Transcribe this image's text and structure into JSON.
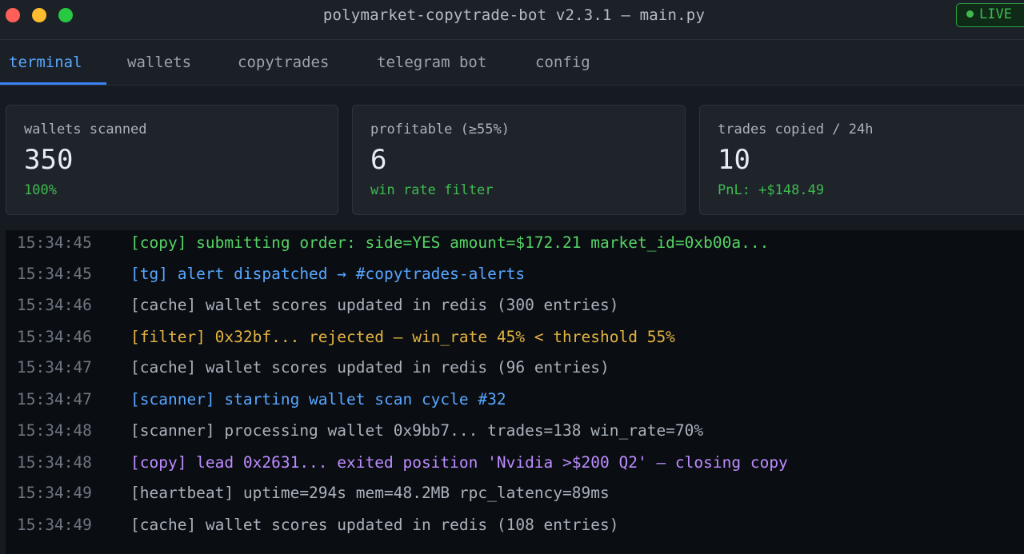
{
  "window": {
    "title": "polymarket-copytrade-bot v2.3.1 — main.py",
    "live_label": "LIVE"
  },
  "tabs": [
    {
      "label": "terminal",
      "active": true
    },
    {
      "label": "wallets",
      "active": false
    },
    {
      "label": "copytrades",
      "active": false
    },
    {
      "label": "telegram bot",
      "active": false
    },
    {
      "label": "config",
      "active": false
    }
  ],
  "stats": [
    {
      "label": "wallets scanned",
      "value": "350",
      "sub": "100%"
    },
    {
      "label": "profitable (≥55%)",
      "value": "6",
      "sub": "win rate filter"
    },
    {
      "label": "trades copied / 24h",
      "value": "10",
      "sub": "PnL: +$148.49"
    }
  ],
  "log": [
    {
      "time": "15:34:45",
      "text": "[copy] submitting order: side=YES amount=$172.21 market_id=0xb00a...",
      "color": "green"
    },
    {
      "time": "15:34:45",
      "text": "[tg] alert dispatched → #copytrades-alerts",
      "color": "blue"
    },
    {
      "time": "15:34:46",
      "text": "[cache] wallet scores updated in redis (300 entries)",
      "color": "gray"
    },
    {
      "time": "15:34:46",
      "text": "[filter] 0x32bf... rejected — win_rate 45% < threshold 55%",
      "color": "amber"
    },
    {
      "time": "15:34:47",
      "text": "[cache] wallet scores updated in redis (96 entries)",
      "color": "gray"
    },
    {
      "time": "15:34:47",
      "text": "[scanner] starting wallet scan cycle #32",
      "color": "blue"
    },
    {
      "time": "15:34:48",
      "text": "[scanner] processing wallet 0x9bb7... trades=138 win_rate=70%",
      "color": "gray"
    },
    {
      "time": "15:34:48",
      "text": "[copy] lead 0x2631... exited position 'Nvidia >$200 Q2' — closing copy",
      "color": "purple"
    },
    {
      "time": "15:34:49",
      "text": "[heartbeat] uptime=294s mem=48.2MB rpc_latency=89ms",
      "color": "gray"
    },
    {
      "time": "15:34:49",
      "text": "[cache] wallet scores updated in redis (108 entries)",
      "color": "gray"
    }
  ],
  "colors": {
    "green": "#56d364",
    "blue": "#58a6ff",
    "gray": "#a9b1bb",
    "amber": "#e3b341",
    "purple": "#bc8cff",
    "accent": "#3b82f6"
  }
}
